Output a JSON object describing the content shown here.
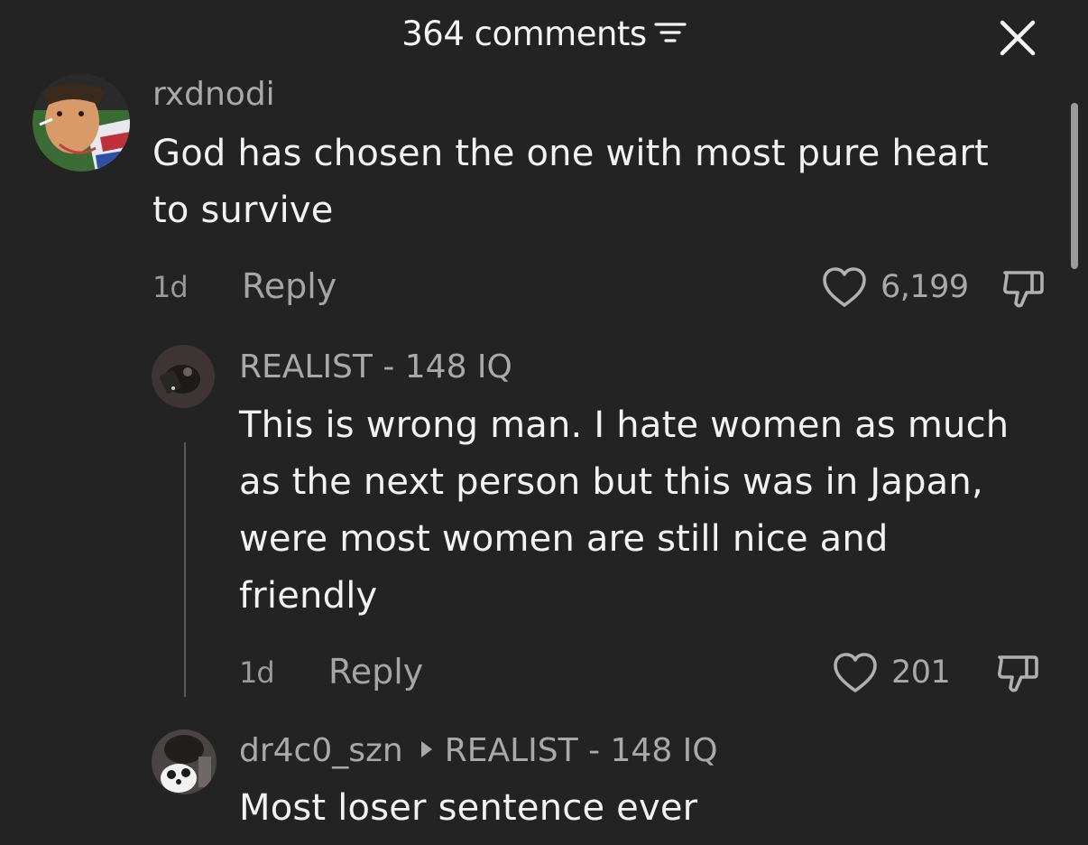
{
  "header": {
    "title": "364 comments",
    "sort_icon": "sort-lines-icon",
    "close_icon": "close-icon"
  },
  "comments": [
    {
      "username": "rxdnodi",
      "text_lines": [
        "God has chosen the one with most pure heart",
        "to survive"
      ],
      "time": "1d",
      "reply_label": "Reply",
      "likes": "6,199"
    },
    {
      "username": "REALIST - 148 IQ",
      "text_lines": [
        "This is wrong man. I hate women as much",
        "as the next person but this was in Japan,",
        "were most women are still nice and",
        "friendly"
      ],
      "time": "1d",
      "reply_label": "Reply",
      "likes": "201"
    },
    {
      "username": "dr4c0_szn",
      "reply_to": "REALIST - 148 IQ",
      "text_lines": [
        "Most loser sentence ever"
      ]
    }
  ],
  "colors": {
    "background": "#232323",
    "text_primary": "#f2f2f2",
    "text_secondary": "#a9a9a9"
  }
}
